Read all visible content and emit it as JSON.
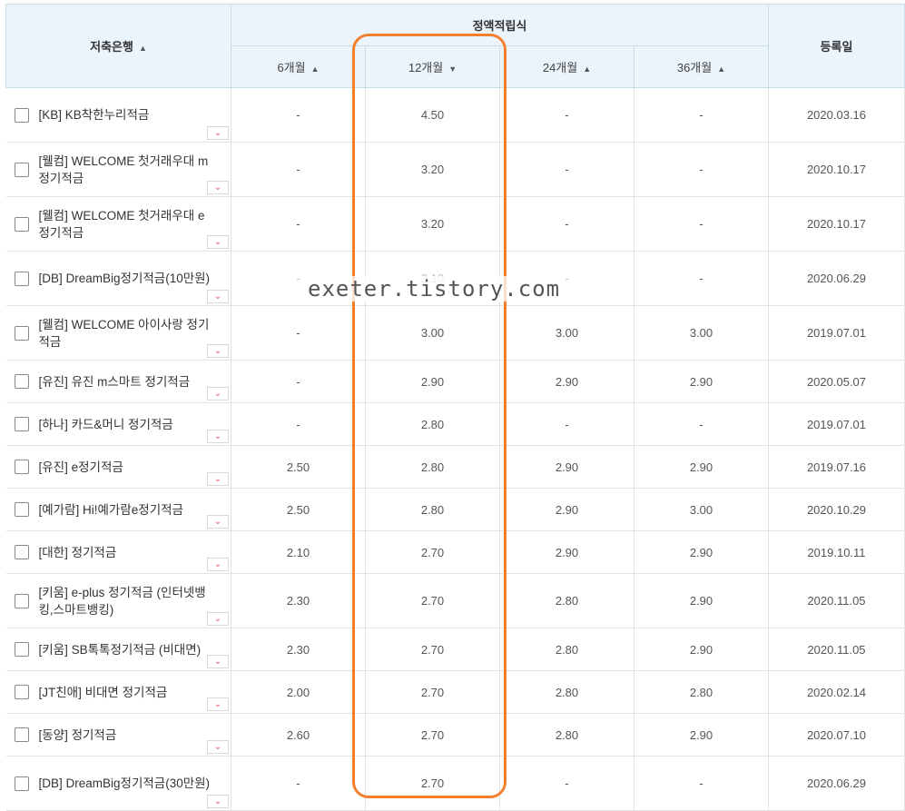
{
  "header": {
    "bank_col": "저축은행",
    "group_col": "정액적립식",
    "months": [
      "6개월",
      "12개월",
      "24개월",
      "36개월"
    ],
    "date_col": "등록일",
    "sort_up": "▲",
    "sort_down": "▼"
  },
  "expand_icon": "chevron-down-icon",
  "highlight_color": "#f47f2e",
  "watermark": "exeter.tistory.com",
  "rows": [
    {
      "name": "[KB] KB착한누리적금",
      "m6": "-",
      "m12": "4.50",
      "m24": "-",
      "m36": "-",
      "date": "2020.03.16"
    },
    {
      "name": "[웰컴] WELCOME 첫거래우대 m정기적금",
      "m6": "-",
      "m12": "3.20",
      "m24": "-",
      "m36": "-",
      "date": "2020.10.17"
    },
    {
      "name": "[웰컴] WELCOME 첫거래우대 e정기적금",
      "m6": "-",
      "m12": "3.20",
      "m24": "-",
      "m36": "-",
      "date": "2020.10.17"
    },
    {
      "name": "[DB] DreamBig정기적금(10만원)",
      "m6": "-",
      "m12": "3.10",
      "m24": "-",
      "m36": "-",
      "date": "2020.06.29"
    },
    {
      "name": "[웰컴] WELCOME 아이사랑 정기적금",
      "m6": "-",
      "m12": "3.00",
      "m24": "3.00",
      "m36": "3.00",
      "date": "2019.07.01"
    },
    {
      "name": "[유진] 유진 m스마트 정기적금",
      "m6": "-",
      "m12": "2.90",
      "m24": "2.90",
      "m36": "2.90",
      "date": "2020.05.07"
    },
    {
      "name": "[하나] 카드&머니 정기적금",
      "m6": "-",
      "m12": "2.80",
      "m24": "-",
      "m36": "-",
      "date": "2019.07.01"
    },
    {
      "name": "[유진] e정기적금",
      "m6": "2.50",
      "m12": "2.80",
      "m24": "2.90",
      "m36": "2.90",
      "date": "2019.07.16"
    },
    {
      "name": "[예가람] Hi!예가람e정기적금",
      "m6": "2.50",
      "m12": "2.80",
      "m24": "2.90",
      "m36": "3.00",
      "date": "2020.10.29"
    },
    {
      "name": "[대한] 정기적금",
      "m6": "2.10",
      "m12": "2.70",
      "m24": "2.90",
      "m36": "2.90",
      "date": "2019.10.11"
    },
    {
      "name": "[키움] e-plus 정기적금 (인터넷뱅킹,스마트뱅킹)",
      "m6": "2.30",
      "m12": "2.70",
      "m24": "2.80",
      "m36": "2.90",
      "date": "2020.11.05"
    },
    {
      "name": "[키움] SB톡톡정기적금 (비대면)",
      "m6": "2.30",
      "m12": "2.70",
      "m24": "2.80",
      "m36": "2.90",
      "date": "2020.11.05"
    },
    {
      "name": "[JT친애] 비대면 정기적금",
      "m6": "2.00",
      "m12": "2.70",
      "m24": "2.80",
      "m36": "2.80",
      "date": "2020.02.14"
    },
    {
      "name": "[동양] 정기적금",
      "m6": "2.60",
      "m12": "2.70",
      "m24": "2.80",
      "m36": "2.90",
      "date": "2020.07.10"
    },
    {
      "name": "[DB] DreamBig정기적금(30만원)",
      "m6": "-",
      "m12": "2.70",
      "m24": "-",
      "m36": "-",
      "date": "2020.06.29"
    }
  ]
}
